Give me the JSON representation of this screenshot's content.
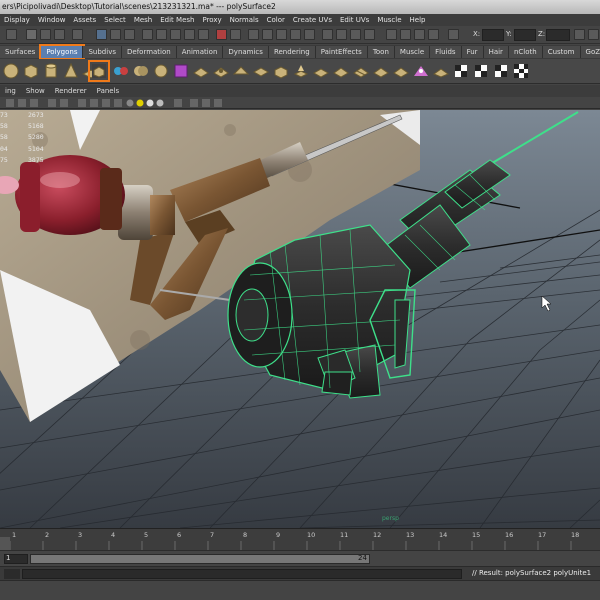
{
  "window": {
    "title": "ers\\Picipolivadi\\Desktop\\Tutorial\\scenes\\213231321.ma*   ---   polySurface2"
  },
  "menus": [
    "Display",
    "Window",
    "Assets",
    "Select",
    "Mesh",
    "Edit Mesh",
    "Proxy",
    "Normals",
    "Color",
    "Create UVs",
    "Edit UVs",
    "Muscle",
    "Help"
  ],
  "status_line": {
    "x_label": "X:",
    "y_label": "Y:",
    "z_label": "Z:"
  },
  "shelf_tabs": {
    "items": [
      "Surfaces",
      "Polygons",
      "Subdivs",
      "Deformation",
      "Animation",
      "Dynamics",
      "Rendering",
      "PaintEffects",
      "Toon",
      "Muscle",
      "Fluids",
      "Fur",
      "Hair",
      "nCloth",
      "Custom",
      "GoZBrush"
    ],
    "active": "Polygons"
  },
  "panel_menu": [
    "ing",
    "Show",
    "Renderer",
    "Panels"
  ],
  "hud": {
    "rows": [
      [
        "73",
        "2673"
      ],
      [
        "58",
        "5168"
      ],
      [
        "58",
        "5280"
      ],
      [
        "04",
        "5104"
      ],
      [
        "75",
        "3875"
      ]
    ]
  },
  "viewport": {
    "object_label": "persp",
    "wire_color": "#3ee08a",
    "sky_color": "#7e8a96"
  },
  "timeline": {
    "ticks": [
      "1",
      "2",
      "3",
      "4",
      "5",
      "6",
      "7",
      "8",
      "9",
      "10",
      "11",
      "12",
      "13",
      "14",
      "15",
      "16",
      "17",
      "18"
    ],
    "range_start": "1",
    "range_end": "24"
  },
  "command_result": "// Result: polySurface2 polyUnite1",
  "colors": {
    "accent_highlight": "#f07a1a",
    "active_tab": "#5b7fb0"
  }
}
